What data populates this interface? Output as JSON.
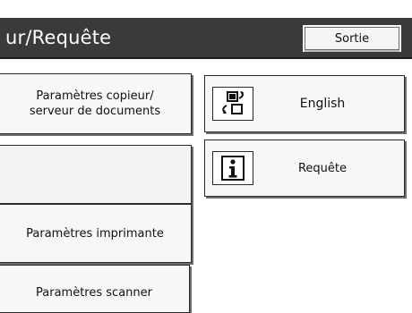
{
  "header": {
    "title": "ur/Requête",
    "exit_label": "Sortie"
  },
  "left_tiles": [
    {
      "label_line1": "Paramètres copieur/",
      "label_line2": "serveur de documents"
    },
    {
      "label": ""
    },
    {
      "label": "Paramètres imprimante"
    },
    {
      "label": "Paramètres scanner"
    }
  ],
  "right_tiles": [
    {
      "label": "English",
      "icon": "language-switch-icon"
    },
    {
      "label": "Requête",
      "icon": "info-icon"
    }
  ]
}
